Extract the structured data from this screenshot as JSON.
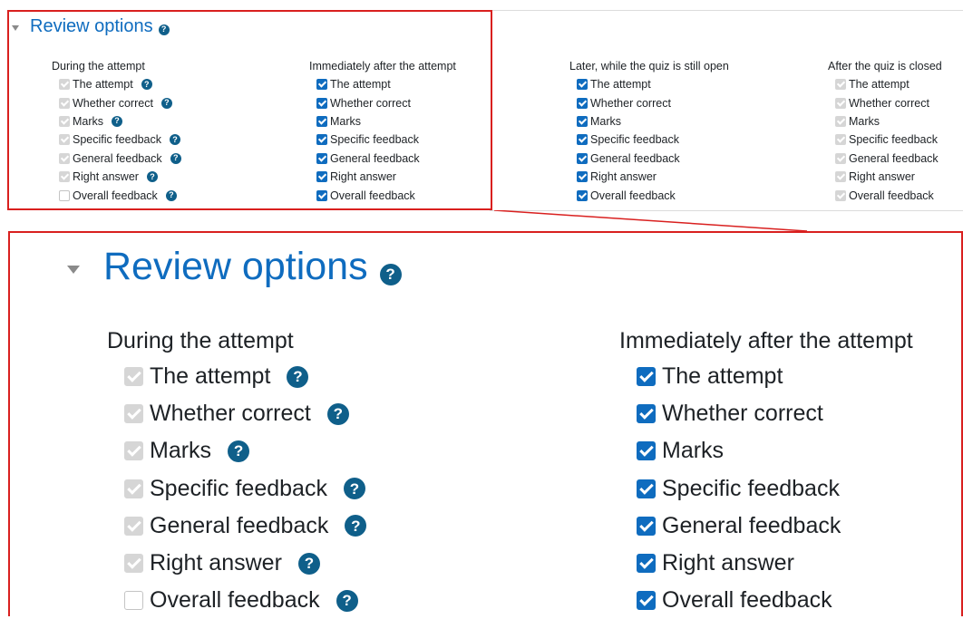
{
  "section_title": "Review options",
  "columns": [
    {
      "heading": "During the attempt",
      "items": [
        {
          "label": "The attempt",
          "state": "disabled-checked",
          "help": true
        },
        {
          "label": "Whether correct",
          "state": "disabled-checked",
          "help": true
        },
        {
          "label": "Marks",
          "state": "disabled-checked",
          "help": true
        },
        {
          "label": "Specific feedback",
          "state": "disabled-checked",
          "help": true
        },
        {
          "label": "General feedback",
          "state": "disabled-checked",
          "help": true
        },
        {
          "label": "Right answer",
          "state": "disabled-checked",
          "help": true
        },
        {
          "label": "Overall feedback",
          "state": "unchecked",
          "help": true
        }
      ]
    },
    {
      "heading": "Immediately after the attempt",
      "items": [
        {
          "label": "The attempt",
          "state": "checked",
          "help": false
        },
        {
          "label": "Whether correct",
          "state": "checked",
          "help": false
        },
        {
          "label": "Marks",
          "state": "checked",
          "help": false
        },
        {
          "label": "Specific feedback",
          "state": "checked",
          "help": false
        },
        {
          "label": "General feedback",
          "state": "checked",
          "help": false
        },
        {
          "label": "Right answer",
          "state": "checked",
          "help": false
        },
        {
          "label": "Overall feedback",
          "state": "checked",
          "help": false
        }
      ]
    },
    {
      "heading": "Later, while the quiz is still open",
      "items": [
        {
          "label": "The attempt",
          "state": "checked",
          "help": false
        },
        {
          "label": "Whether correct",
          "state": "checked",
          "help": false
        },
        {
          "label": "Marks",
          "state": "checked",
          "help": false
        },
        {
          "label": "Specific feedback",
          "state": "checked",
          "help": false
        },
        {
          "label": "General feedback",
          "state": "checked",
          "help": false
        },
        {
          "label": "Right answer",
          "state": "checked",
          "help": false
        },
        {
          "label": "Overall feedback",
          "state": "checked",
          "help": false
        }
      ]
    },
    {
      "heading": "After the quiz is closed",
      "items": [
        {
          "label": "The attempt",
          "state": "disabled-checked",
          "help": false
        },
        {
          "label": "Whether correct",
          "state": "disabled-checked",
          "help": false
        },
        {
          "label": "Marks",
          "state": "disabled-checked",
          "help": false
        },
        {
          "label": "Specific feedback",
          "state": "disabled-checked",
          "help": false
        },
        {
          "label": "General feedback",
          "state": "disabled-checked",
          "help": false
        },
        {
          "label": "Right answer",
          "state": "disabled-checked",
          "help": false
        },
        {
          "label": "Overall feedback",
          "state": "disabled-checked",
          "help": false
        }
      ]
    }
  ],
  "help_glyph": "?",
  "icons": {
    "help": "question-circle-icon",
    "caret": "caret-down-icon",
    "checkbox": "checkbox-icon"
  },
  "colors": {
    "link": "#0f6cbf",
    "checkbox_on": "#0f6cbf",
    "checkbox_disabled": "#d6d6d6",
    "help_icon": "#0f5f8a",
    "highlight": "#d9201f"
  }
}
